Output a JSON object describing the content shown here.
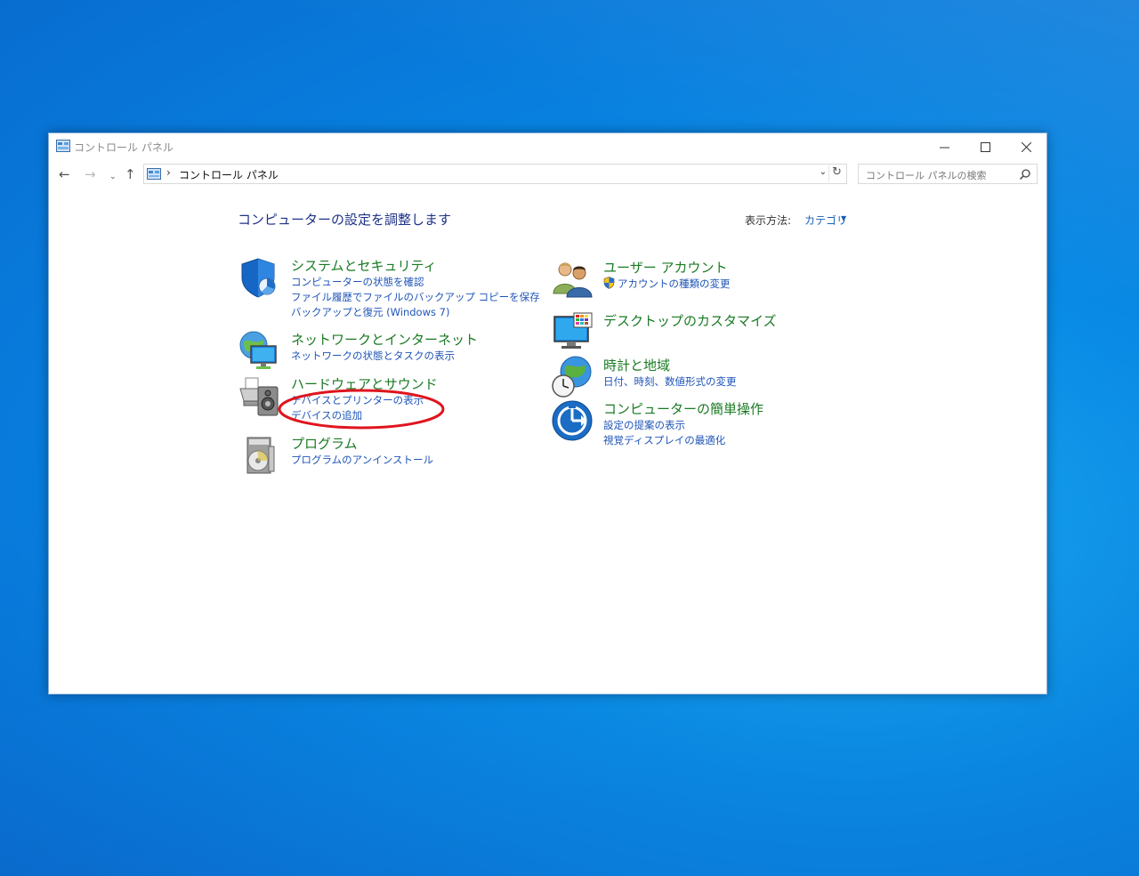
{
  "window": {
    "title": "コントロール パネル",
    "controls": {
      "minimize": "—",
      "maximize": "☐",
      "close": "✕"
    }
  },
  "navigation": {
    "back": "←",
    "forward": "→",
    "recent": "⌄",
    "up": "↑",
    "address_separator": "›",
    "address_text": "コントロール パネル",
    "address_dropdown": "⌄",
    "refresh": "↻",
    "search_placeholder": "コントロール パネルの検索"
  },
  "main": {
    "heading": "コンピューターの設定を調整します",
    "view_by_label": "表示方法:",
    "view_by_value": "カテゴリ",
    "view_by_arrow": "▼"
  },
  "categories": {
    "system_security": {
      "title": "システムとセキュリティ",
      "links": [
        "コンピューターの状態を確認",
        "ファイル履歴でファイルのバックアップ コピーを保存",
        "バックアップと復元 (Windows 7)"
      ]
    },
    "network_internet": {
      "title": "ネットワークとインターネット",
      "links": [
        "ネットワークの状態とタスクの表示"
      ]
    },
    "hardware_sound": {
      "title": "ハードウェアとサウンド",
      "links": [
        "デバイスとプリンターの表示",
        "デバイスの追加"
      ]
    },
    "programs": {
      "title": "プログラム",
      "links": [
        "プログラムのアンインストール"
      ]
    },
    "user_accounts": {
      "title": "ユーザー アカウント",
      "links": [
        "アカウントの種類の変更"
      ]
    },
    "appearance": {
      "title": "デスクトップのカスタマイズ",
      "links": []
    },
    "clock_region": {
      "title": "時計と地域",
      "links": [
        "日付、時刻、数値形式の変更"
      ]
    },
    "ease_of_access": {
      "title": "コンピューターの簡単操作",
      "links": [
        "設定の提案の表示",
        "視覚ディスプレイの最適化"
      ]
    }
  },
  "colors": {
    "category_title": "#1a7a23",
    "link": "#1f55b8",
    "heading": "#1e3287",
    "annotation": "#e0141e"
  }
}
